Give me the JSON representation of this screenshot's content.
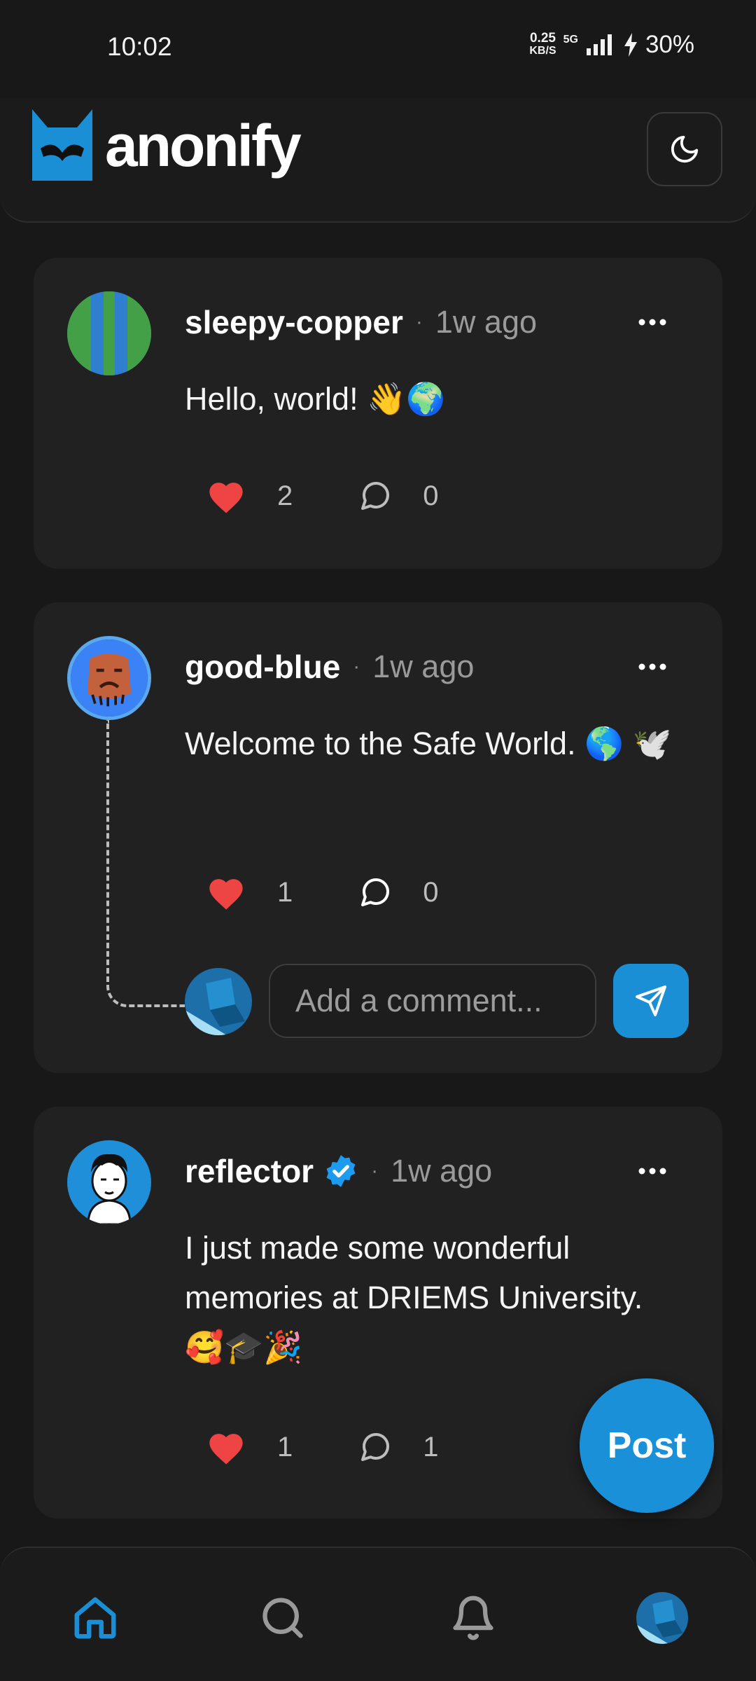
{
  "status_bar": {
    "time": "10:02",
    "net_speed_value": "0.25",
    "net_speed_unit": "KB/S",
    "network_type": "5G",
    "battery": "30%"
  },
  "header": {
    "app_title": "anonify"
  },
  "posts": [
    {
      "username": "sleepy-copper",
      "separator": "·",
      "time_ago": "1w ago",
      "text": "Hello, world! 👋🌍",
      "likes": "2",
      "comments": "0"
    },
    {
      "username": "good-blue",
      "separator": "·",
      "time_ago": "1w ago",
      "text": "Welcome to the Safe World. 🌎 🕊️",
      "likes": "1",
      "comments": "0"
    },
    {
      "username": "reflector",
      "separator": "·",
      "time_ago": "1w ago",
      "text": "I just made some wonderful memories at DRIEMS University. 🥰🎓🎉",
      "likes": "1",
      "comments": "1",
      "verified": true
    }
  ],
  "comment_box": {
    "placeholder": "Add a comment..."
  },
  "fab": {
    "label": "Post"
  },
  "colors": {
    "background": "#181818",
    "card": "#212121",
    "accent": "#1a8fd6",
    "like": "#ef4444",
    "muted_text": "#9a9a9a"
  },
  "icons": {
    "logo": "mask-logo-icon",
    "theme": "moon-icon",
    "more": "more-horizontal-icon",
    "like": "heart-icon",
    "comment": "comment-bubble-icon",
    "send": "send-icon",
    "verified": "verified-badge-icon",
    "nav": [
      "home-icon",
      "search-icon",
      "bell-icon",
      "profile-avatar"
    ]
  }
}
